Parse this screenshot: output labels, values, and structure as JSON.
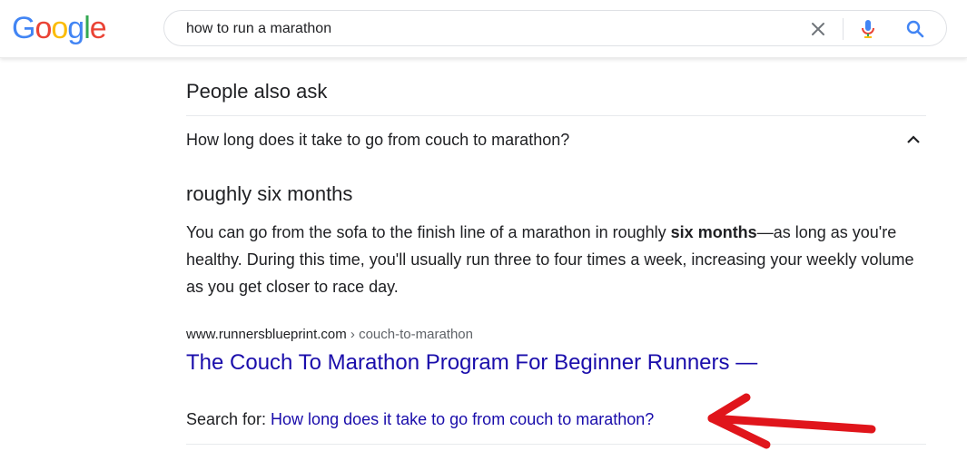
{
  "header": {
    "logo_letters": [
      {
        "ch": "G",
        "color": "#4285F4"
      },
      {
        "ch": "o",
        "color": "#EA4335"
      },
      {
        "ch": "o",
        "color": "#FBBC05"
      },
      {
        "ch": "g",
        "color": "#4285F4"
      },
      {
        "ch": "l",
        "color": "#34A853"
      },
      {
        "ch": "e",
        "color": "#EA4335"
      }
    ],
    "search_value": "how to run a marathon",
    "icons": {
      "clear": "close-icon",
      "mic": "microphone-icon",
      "search": "search-icon"
    }
  },
  "paa": {
    "title": "People also ask",
    "question": "How long does it take to go from couch to marathon?",
    "answer_heading": "roughly six months",
    "answer_pre": "You can go from the sofa to the finish line of a marathon in roughly ",
    "answer_bold": "six months",
    "answer_post": "—as long as you're healthy. During this time, you'll usually run three to four times a week, increasing your weekly volume as you get closer to race day.",
    "cite_domain": "www.runnersblueprint.com",
    "cite_path": " › couch-to-marathon",
    "result_title": "The Couch To Marathon Program For Beginner Runners —",
    "search_for_label": "Search for: ",
    "search_for_link": "How long does it take to go from couch to marathon?"
  },
  "annotation": {
    "type": "red-arrow",
    "color": "#e0151b"
  }
}
